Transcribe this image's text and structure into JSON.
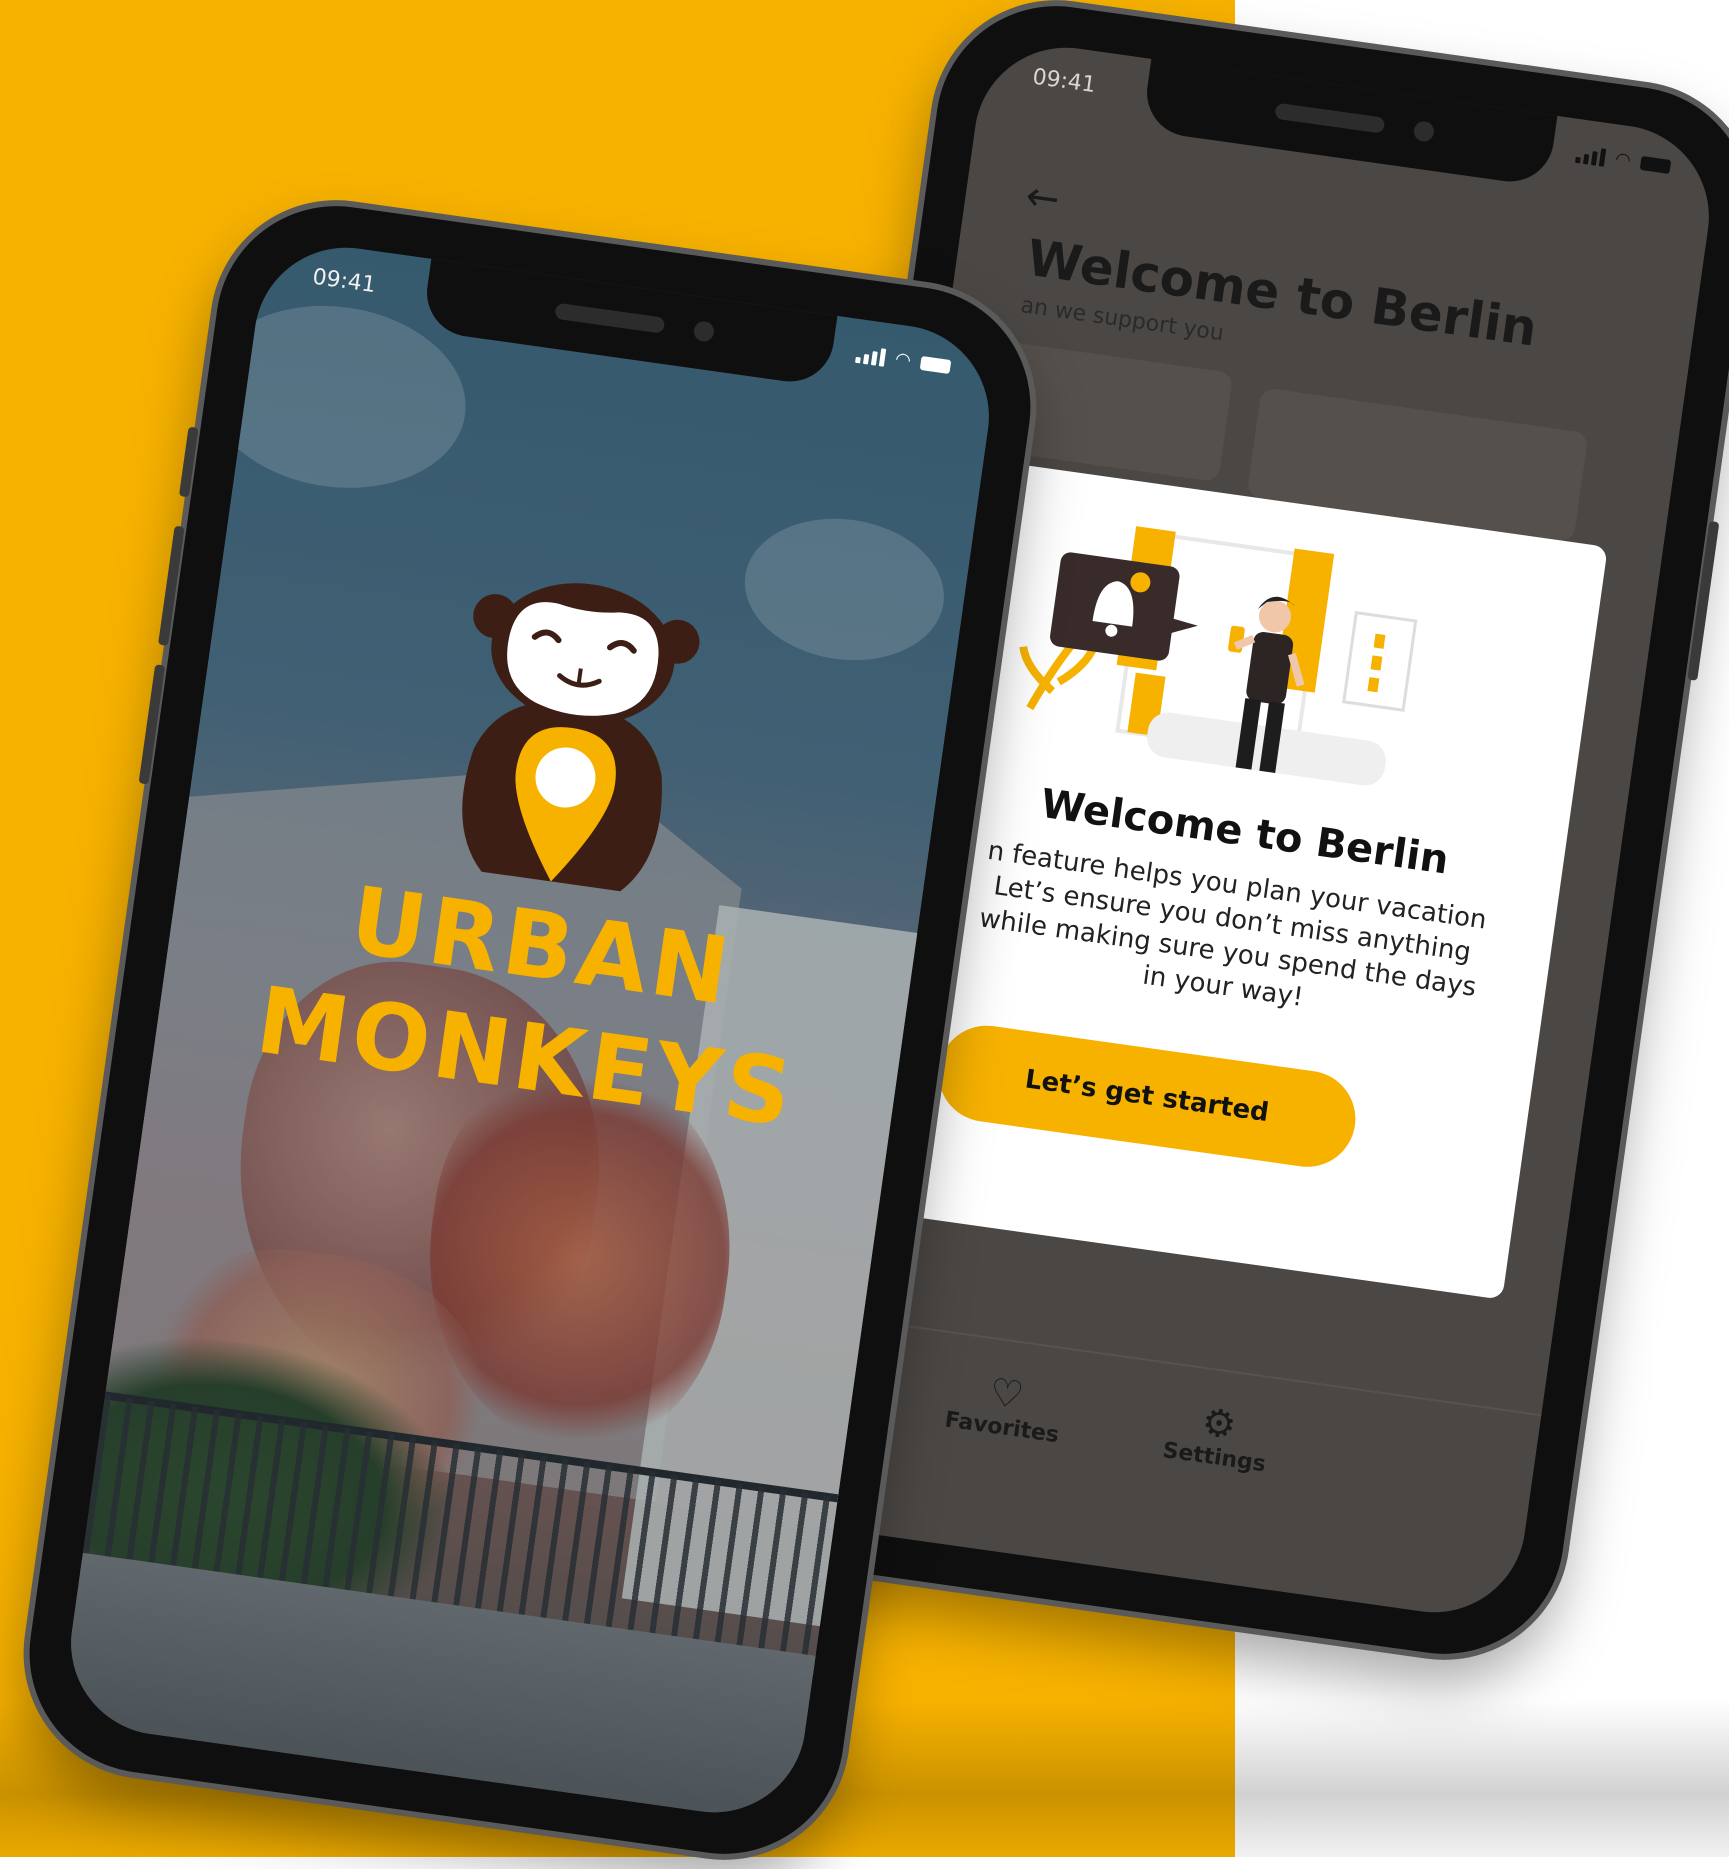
{
  "colors": {
    "brand_yellow": "#f7b200",
    "monkey_brown": "#3d1e14",
    "dim_screen": "#4b4744",
    "white": "#ffffff"
  },
  "splash_phone": {
    "status_time": "09:41",
    "brand_line1": "URBAN",
    "brand_line2": "MONKEYS",
    "logo_icon": "monkey-holding-location-pin"
  },
  "welcome_phone": {
    "status_time": "09:41",
    "back_icon": "arrow-left",
    "header_title": "Welcome to Berlin",
    "header_subtitle": "an we support you",
    "modal": {
      "title": "Welcome to Berlin",
      "body_line1": "n feature helps you plan your vacation",
      "body_line2": "Let’s ensure you don’t miss anything",
      "body_line3": "while making sure you spend the days",
      "body_line4": "in your way!",
      "cta_label": "Let’s get started",
      "illustration_icon": "man-with-phone-notification-bell"
    },
    "tabbar": {
      "favorites_label": "Favorites",
      "favorites_icon": "heart-icon",
      "settings_label": "Settings",
      "settings_icon": "gear-icon"
    }
  }
}
